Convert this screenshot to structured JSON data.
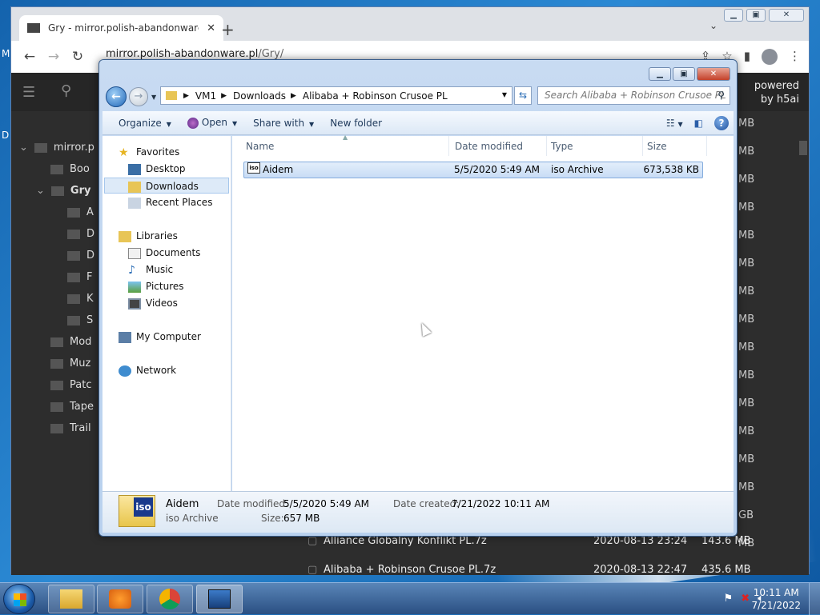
{
  "desktop_letters": [
    "M",
    "D"
  ],
  "browser": {
    "tab_title": "Gry - mirror.polish-abandonware",
    "tab_close": "✕",
    "new_tab": "+",
    "tab_dropdown": "⌄",
    "url_prefix": "mirror.polish-abandonware.pl",
    "url_path": "/Gry/",
    "powered_line1": "powered",
    "powered_line2": "by h5ai",
    "tree": [
      {
        "label": "mirror.p",
        "indent": 0,
        "arrow": "⌄"
      },
      {
        "label": "Boo",
        "indent": 1,
        "arrow": ""
      },
      {
        "label": "Gry",
        "indent": 1,
        "arrow": "⌄"
      },
      {
        "label": "A",
        "indent": 2,
        "arrow": ""
      },
      {
        "label": "D",
        "indent": 2,
        "arrow": ""
      },
      {
        "label": "D",
        "indent": 2,
        "arrow": ""
      },
      {
        "label": "F",
        "indent": 2,
        "arrow": ""
      },
      {
        "label": "K",
        "indent": 2,
        "arrow": ""
      },
      {
        "label": "S",
        "indent": 2,
        "arrow": ""
      },
      {
        "label": "Mod",
        "indent": 1,
        "arrow": ""
      },
      {
        "label": "Muz",
        "indent": 1,
        "arrow": ""
      },
      {
        "label": "Patc",
        "indent": 1,
        "arrow": ""
      },
      {
        "label": "Tape",
        "indent": 1,
        "arrow": ""
      },
      {
        "label": "Trail",
        "indent": 1,
        "arrow": ""
      }
    ],
    "sizes": [
      "MB",
      "MB",
      "MB",
      "MB",
      "MB",
      "MB",
      "MB",
      "MB",
      "MB",
      "MB",
      "MB",
      "MB",
      "MB",
      "MB",
      "GB",
      "MB"
    ],
    "bottom_rows": [
      {
        "name": "Alliance Globalny Konflikt PL.7z",
        "date": "2020-08-13 23:24",
        "size": "143.6 MB"
      },
      {
        "name": "Alibaba + Robinson Crusoe PL.7z",
        "date": "2020-08-13 22:47",
        "size": "435.6 MB"
      }
    ]
  },
  "explorer": {
    "breadcrumb": [
      "VM1",
      "Downloads",
      "Alibaba + Robinson Crusoe PL"
    ],
    "search_placeholder": "Search Alibaba + Robinson Crusoe PL",
    "toolbar": {
      "organize": "Organize",
      "open": "Open",
      "share_with": "Share with",
      "new_folder": "New folder"
    },
    "nav": {
      "favorites": "Favorites",
      "desktop": "Desktop",
      "downloads": "Downloads",
      "recent": "Recent Places",
      "libraries": "Libraries",
      "documents": "Documents",
      "music": "Music",
      "pictures": "Pictures",
      "videos": "Videos",
      "computer": "My Computer",
      "network": "Network"
    },
    "columns": {
      "name": "Name",
      "date": "Date modified",
      "type": "Type",
      "size": "Size"
    },
    "files": [
      {
        "name": "Aidem",
        "date": "5/5/2020 5:49 AM",
        "type": "iso Archive",
        "size": "673,538 KB"
      }
    ],
    "details": {
      "name": "Aidem",
      "type": "iso Archive",
      "modified_label": "Date modified:",
      "modified": "5/5/2020 5:49 AM",
      "size_label": "Size:",
      "size": "657 MB",
      "created_label": "Date created:",
      "created": "7/21/2022 10:11 AM",
      "icon_text": "iso"
    }
  },
  "taskbar": {
    "time": "10:11 AM",
    "date": "7/21/2022"
  }
}
